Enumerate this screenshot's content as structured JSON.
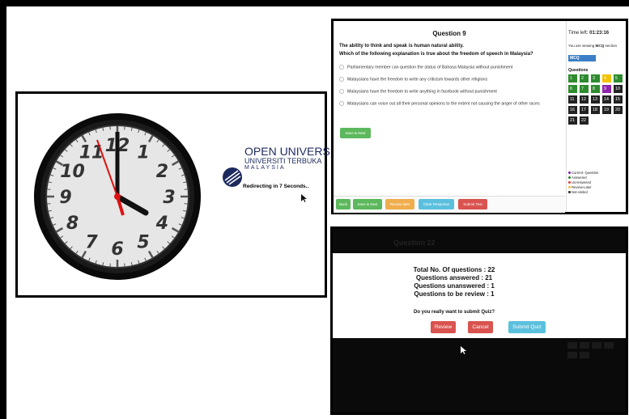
{
  "clock_screen": {
    "logo_line1": "OPEN UNIVERSITY",
    "logo_line2": "UNIVERSITI TERBUKA",
    "logo_line3": "MALAYSIA",
    "redirect_text": "Redirecting in 7 Seconds..",
    "clock_numerals": [
      "12",
      "1",
      "2",
      "3",
      "4",
      "5",
      "6",
      "7",
      "8",
      "9",
      "10",
      "11"
    ]
  },
  "quiz": {
    "title": "Question 9",
    "stem": "The ability to think and speak is human natural ability.",
    "question": "Which of the following explanation is true about the freedom of speech in Malaysia?",
    "options": [
      "Parliamentary member can question the status of Bahasa Malaysia without punishment",
      "Malaysians have the freedom to write any criticism towards other religions",
      "Malaysians have the freedom to write anything in facebook without punishment",
      "Malaysians can voice out all their personal opinions to the extent not causing the anger of other races"
    ],
    "save_next_label": "Save & Next",
    "bottom_buttons": {
      "back": "Back",
      "save_next": "Save & Next",
      "review_later": "Review later",
      "clear_response": "Clear Response",
      "submit_test": "Submit Test"
    },
    "timer_label": "Time left:",
    "timer_value": "01:23:16",
    "viewing_prefix": "You are viewing",
    "viewing_section": "MCQ",
    "viewing_suffix": "section",
    "section_tab": "MCQ",
    "questions_label": "Questions",
    "question_numbers": [
      {
        "n": "1",
        "status": "answered"
      },
      {
        "n": "2",
        "status": "answered"
      },
      {
        "n": "3",
        "status": "answered"
      },
      {
        "n": "4",
        "status": "review"
      },
      {
        "n": "5",
        "status": "answered"
      },
      {
        "n": "6",
        "status": "answered"
      },
      {
        "n": "7",
        "status": "answered"
      },
      {
        "n": "8",
        "status": "answered"
      },
      {
        "n": "9",
        "status": "current"
      },
      {
        "n": "10",
        "status": "notvisited"
      },
      {
        "n": "11",
        "status": "notvisited"
      },
      {
        "n": "12",
        "status": "notvisited"
      },
      {
        "n": "13",
        "status": "notvisited"
      },
      {
        "n": "14",
        "status": "notvisited"
      },
      {
        "n": "15",
        "status": "notvisited"
      },
      {
        "n": "16",
        "status": "notvisited"
      },
      {
        "n": "17",
        "status": "notvisited"
      },
      {
        "n": "18",
        "status": "notvisited"
      },
      {
        "n": "19",
        "status": "notvisited"
      },
      {
        "n": "20",
        "status": "notvisited"
      },
      {
        "n": "21",
        "status": "notvisited"
      },
      {
        "n": "22",
        "status": "notvisited"
      }
    ],
    "legend": [
      {
        "label": "Current- Question",
        "color": "#7b1fa2"
      },
      {
        "label": "Answered",
        "color": "#2e7d32"
      },
      {
        "label": "UnAnswered",
        "color": "#e53935"
      },
      {
        "label": "Review-Later",
        "color": "#fbc02d"
      },
      {
        "label": "Not-visited",
        "color": "#222222"
      }
    ],
    "colors": {
      "answered": "#2e8b2e",
      "review": "#f2c200",
      "current": "#8e24aa",
      "notvisited": "#222222",
      "green_btn": "#5cb85c",
      "orange_btn": "#f0ad4e",
      "blue_btn": "#5bc0de",
      "red_btn": "#d9534f"
    }
  },
  "dialog": {
    "background_title": "Question 22",
    "total": "Total No. Of questions : 22",
    "answered": "Questions answered : 21",
    "unanswered": "Questions unanswered : 1",
    "review": "Questions to be review : 1",
    "ask": "Do you really want to submit Quiz?",
    "review_button": "Review",
    "cancel_button": "Cancel",
    "submit_button": "Submit Quiz"
  }
}
